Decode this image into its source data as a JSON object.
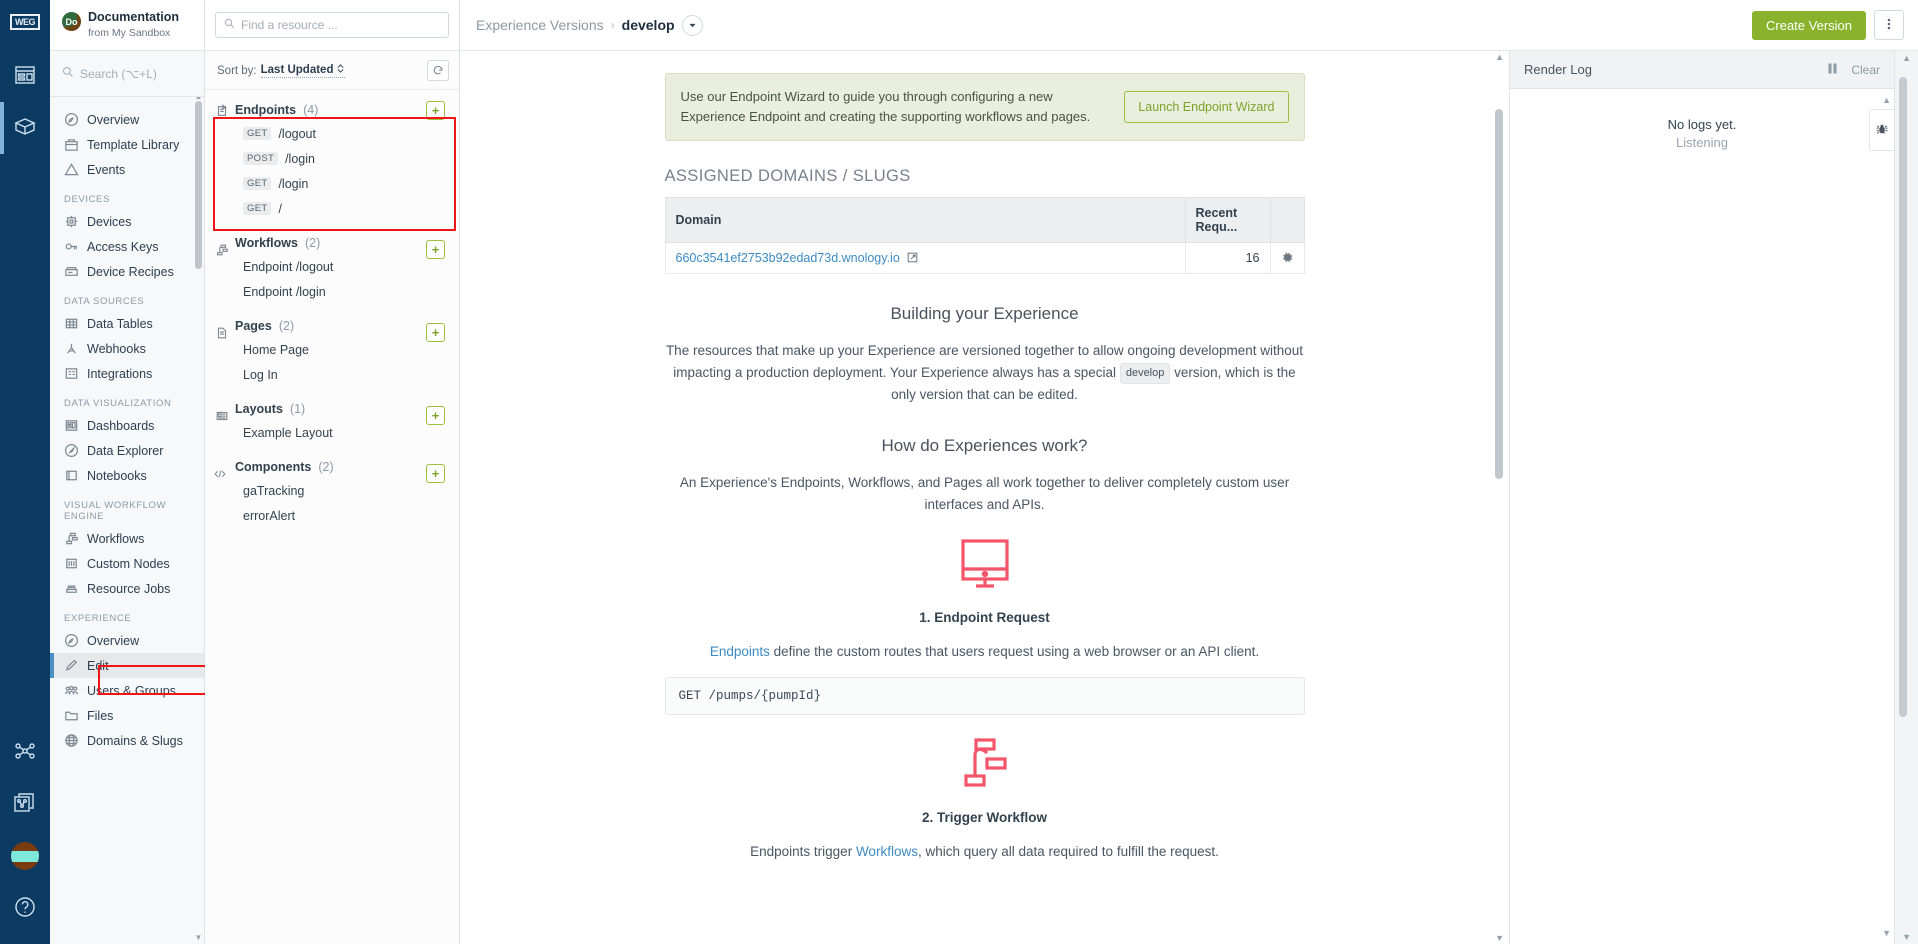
{
  "rail": {
    "logo_text": "WEG",
    "items": [
      {
        "name": "dashboard-icon",
        "label": "Dashboards"
      },
      {
        "name": "package-icon",
        "label": "Applications",
        "active": true
      },
      {
        "name": "workflow-icon",
        "label": "Workflows"
      },
      {
        "name": "workflow-stack-icon",
        "label": "Workflow Versions"
      },
      {
        "name": "avatar",
        "label": "Account"
      },
      {
        "name": "help-icon",
        "label": "Help"
      }
    ]
  },
  "sidebar": {
    "brand": {
      "badge": "Do",
      "title": "Documentation",
      "subtitle": "from My Sandbox"
    },
    "search": {
      "placeholder": "Search (⌥+L)",
      "icon": "search-icon"
    },
    "groups": [
      {
        "label": "",
        "items": [
          {
            "label": "Overview",
            "icon": "overview-icon"
          },
          {
            "label": "Template Library",
            "icon": "library-icon"
          },
          {
            "label": "Events",
            "icon": "warning-icon"
          }
        ]
      },
      {
        "label": "DEVICES",
        "items": [
          {
            "label": "Devices",
            "icon": "chip-icon"
          },
          {
            "label": "Access Keys",
            "icon": "key-icon"
          },
          {
            "label": "Device Recipes",
            "icon": "recipe-icon"
          }
        ]
      },
      {
        "label": "DATA SOURCES",
        "items": [
          {
            "label": "Data Tables",
            "icon": "table-icon"
          },
          {
            "label": "Webhooks",
            "icon": "webhook-icon"
          },
          {
            "label": "Integrations",
            "icon": "integration-icon"
          }
        ]
      },
      {
        "label": "DATA VISUALIZATION",
        "items": [
          {
            "label": "Dashboards",
            "icon": "dashboard-icon"
          },
          {
            "label": "Data Explorer",
            "icon": "compass-icon"
          },
          {
            "label": "Notebooks",
            "icon": "notebook-icon"
          }
        ]
      },
      {
        "label": "VISUAL WORKFLOW ENGINE",
        "items": [
          {
            "label": "Workflows",
            "icon": "workflow-icon"
          },
          {
            "label": "Custom Nodes",
            "icon": "sliders-icon"
          },
          {
            "label": "Resource Jobs",
            "icon": "server-icon"
          }
        ]
      },
      {
        "label": "EXPERIENCE",
        "items": [
          {
            "label": "Overview",
            "icon": "overview-icon"
          },
          {
            "label": "Edit",
            "icon": "pencil-icon",
            "selected": true
          },
          {
            "label": "Users & Groups",
            "icon": "users-icon"
          },
          {
            "label": "Files",
            "icon": "folder-icon"
          },
          {
            "label": "Domains & Slugs",
            "icon": "globe-icon"
          }
        ]
      }
    ]
  },
  "resource_panel": {
    "find": {
      "placeholder": "Find a resource ...",
      "icon": "search-icon"
    },
    "sort": {
      "label": "Sort by:",
      "value": "Last Updated",
      "refresh_icon": "refresh-icon"
    },
    "add_label": "+",
    "sections": [
      {
        "title": "Endpoints",
        "count": "(4)",
        "icon": "endpoint-icon",
        "highlighted": true,
        "children": [
          {
            "verb": "GET",
            "path": "/logout"
          },
          {
            "verb": "POST",
            "path": "/login"
          },
          {
            "verb": "GET",
            "path": "/login"
          },
          {
            "verb": "GET",
            "path": "/"
          }
        ]
      },
      {
        "title": "Workflows",
        "count": "(2)",
        "icon": "workflow-icon",
        "children": [
          {
            "path": "Endpoint /logout"
          },
          {
            "path": "Endpoint /login"
          }
        ]
      },
      {
        "title": "Pages",
        "count": "(2)",
        "icon": "page-icon",
        "children": [
          {
            "path": "Home Page"
          },
          {
            "path": "Log In"
          }
        ]
      },
      {
        "title": "Layouts",
        "count": "(1)",
        "icon": "layout-icon",
        "children": [
          {
            "path": "Example Layout"
          }
        ]
      },
      {
        "title": "Components",
        "count": "(2)",
        "icon": "code-icon",
        "children": [
          {
            "path": "gaTracking"
          },
          {
            "path": "errorAlert"
          }
        ]
      }
    ]
  },
  "topbar": {
    "breadcrumb_root": "Experience Versions",
    "breadcrumb_sep": "›",
    "breadcrumb_current": "develop",
    "caret_icon": "chevron-down-icon",
    "create_version_label": "Create Version",
    "kebab_icon": "kebab-menu-icon"
  },
  "main": {
    "banner": {
      "text": "Use our Endpoint Wizard to guide you through configuring a new Experience Endpoint and creating the supporting workflows and pages.",
      "button_label": "Launch Endpoint Wizard"
    },
    "domains_section": {
      "title": "ASSIGNED DOMAINS / SLUGS",
      "columns": [
        "Domain",
        "Recent Requ...",
        ""
      ],
      "rows": [
        {
          "domain": "660c3541ef2753b92edad73d.wnology.io",
          "external_icon": "external-link-icon",
          "recent_requests": "16",
          "gear_icon": "gear-icon"
        }
      ]
    },
    "building": {
      "heading": "Building your Experience",
      "body_before": "The resources that make up your Experience are versioned together to allow ongoing development without impacting a production deployment. Your Experience always has a special",
      "chip": "develop",
      "body_after": "version, which is the only version that can be edited."
    },
    "how": {
      "heading": "How do Experiences work?",
      "body": "An Experience's Endpoints, Workflows, and Pages all work together to deliver completely custom user interfaces and APIs."
    },
    "steps": [
      {
        "graphic_icon": "monitor-icon",
        "title": "1. Endpoint Request",
        "link_text": "Endpoints",
        "body": " define the custom routes that users request using a web browser or an API client.",
        "code": "GET /pumps/{pumpId}"
      },
      {
        "graphic_icon": "workflow-icon",
        "title": "2. Trigger Workflow",
        "body_before": "Endpoints trigger ",
        "link_text": "Workflows",
        "body_after": ", which query all data required to fulfill the request."
      }
    ]
  },
  "render_log": {
    "title": "Render Log",
    "pause_icon": "pause-icon",
    "clear_label": "Clear",
    "empty_primary": "No logs yet.",
    "empty_secondary": "Listening",
    "bug_icon": "bug-icon"
  },
  "colors": {
    "rail_bg": "#0b3a63",
    "accent_green": "#89b32d",
    "highlight_red": "#f01616",
    "link_blue": "#3d8bc4",
    "graphic_pink": "#f4556b"
  }
}
